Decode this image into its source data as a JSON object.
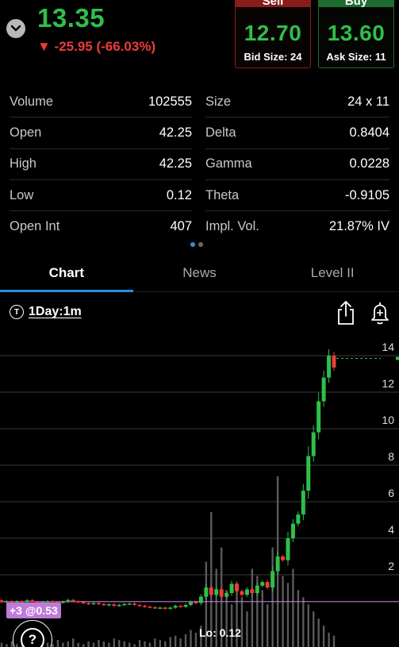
{
  "quote": {
    "last_price": "13.35",
    "change": "▼ -25.95 (-66.03%)"
  },
  "sell": {
    "label": "Sell",
    "price": "12.70",
    "size_text": "Bid Size: 24"
  },
  "buy": {
    "label": "Buy",
    "price": "13.60",
    "size_text": "Ask Size: 11"
  },
  "stats_left": [
    {
      "label": "Volume",
      "value": "102555"
    },
    {
      "label": "Open",
      "value": "42.25"
    },
    {
      "label": "High",
      "value": "42.25"
    },
    {
      "label": "Low",
      "value": "0.12"
    },
    {
      "label": "Open Int",
      "value": "407"
    }
  ],
  "stats_right": [
    {
      "label": "Size",
      "value": "24 x 11"
    },
    {
      "label": "Delta",
      "value": "0.8404"
    },
    {
      "label": "Gamma",
      "value": "0.0228"
    },
    {
      "label": "Theta",
      "value": "-0.9105"
    },
    {
      "label": "Impl. Vol.",
      "value": "21.87% IV"
    }
  ],
  "tabs": [
    {
      "label": "Chart",
      "active": true
    },
    {
      "label": "News",
      "active": false
    },
    {
      "label": "Level II",
      "active": false
    }
  ],
  "toolbar": {
    "interval_icon": "T",
    "interval_label": "1Day:1m"
  },
  "chart": {
    "position_tag": "+3 @0.53",
    "low_label": "Lo: 0.12",
    "help_label": "?",
    "colors": {
      "up": "#2fbf4a",
      "down": "#ef3b3b",
      "grid": "#3a3a3a",
      "volume": "#5a5a5a",
      "position": "#c07ad8"
    }
  },
  "chart_data": {
    "type": "candlestick",
    "y_ticks": [
      "2",
      "4",
      "6",
      "8",
      "10",
      "12",
      "14"
    ],
    "ylim": [
      0,
      15
    ],
    "last_price": 13.35,
    "low": 0.12,
    "position_price": 0.53,
    "candles": [
      {
        "o": 0.6,
        "c": 0.5
      },
      {
        "o": 0.5,
        "c": 0.55
      },
      {
        "o": 0.55,
        "c": 0.45
      },
      {
        "o": 0.45,
        "c": 0.55
      },
      {
        "o": 0.55,
        "c": 0.5
      },
      {
        "o": 0.5,
        "c": 0.6
      },
      {
        "o": 0.6,
        "c": 0.5
      },
      {
        "o": 0.5,
        "c": 0.45
      },
      {
        "o": 0.45,
        "c": 0.5
      },
      {
        "o": 0.5,
        "c": 0.55
      },
      {
        "o": 0.55,
        "c": 0.5
      },
      {
        "o": 0.5,
        "c": 0.48
      },
      {
        "o": 0.48,
        "c": 0.52
      },
      {
        "o": 0.52,
        "c": 0.62
      },
      {
        "o": 0.62,
        "c": 0.55
      },
      {
        "o": 0.55,
        "c": 0.5
      },
      {
        "o": 0.5,
        "c": 0.45
      },
      {
        "o": 0.45,
        "c": 0.4
      },
      {
        "o": 0.4,
        "c": 0.45
      },
      {
        "o": 0.45,
        "c": 0.4
      },
      {
        "o": 0.4,
        "c": 0.35
      },
      {
        "o": 0.35,
        "c": 0.38
      },
      {
        "o": 0.38,
        "c": 0.3
      },
      {
        "o": 0.3,
        "c": 0.35
      },
      {
        "o": 0.35,
        "c": 0.4
      },
      {
        "o": 0.4,
        "c": 0.42
      },
      {
        "o": 0.42,
        "c": 0.35
      },
      {
        "o": 0.35,
        "c": 0.3
      },
      {
        "o": 0.3,
        "c": 0.25
      },
      {
        "o": 0.25,
        "c": 0.22
      },
      {
        "o": 0.22,
        "c": 0.18
      },
      {
        "o": 0.18,
        "c": 0.2
      },
      {
        "o": 0.2,
        "c": 0.15
      },
      {
        "o": 0.15,
        "c": 0.2
      },
      {
        "o": 0.2,
        "c": 0.3
      },
      {
        "o": 0.3,
        "c": 0.25
      },
      {
        "o": 0.25,
        "c": 0.35
      },
      {
        "o": 0.35,
        "c": 0.5
      },
      {
        "o": 0.5,
        "c": 0.45
      },
      {
        "o": 0.45,
        "c": 0.8
      },
      {
        "o": 0.8,
        "c": 1.3
      },
      {
        "o": 1.3,
        "c": 0.9
      },
      {
        "o": 0.9,
        "c": 1.2
      },
      {
        "o": 1.2,
        "c": 0.8
      },
      {
        "o": 0.8,
        "c": 1.0
      },
      {
        "o": 1.0,
        "c": 1.5
      },
      {
        "o": 1.5,
        "c": 1.1
      },
      {
        "o": 1.1,
        "c": 0.9
      },
      {
        "o": 0.9,
        "c": 1.2
      },
      {
        "o": 1.2,
        "c": 1.0
      },
      {
        "o": 1.0,
        "c": 1.4
      },
      {
        "o": 1.4,
        "c": 1.6
      },
      {
        "o": 1.6,
        "c": 1.3
      },
      {
        "o": 1.3,
        "c": 2.2
      },
      {
        "o": 2.2,
        "c": 3.0
      },
      {
        "o": 3.0,
        "c": 2.8
      },
      {
        "o": 2.8,
        "c": 4.0
      },
      {
        "o": 4.0,
        "c": 4.8
      },
      {
        "o": 4.8,
        "c": 5.3
      },
      {
        "o": 5.3,
        "c": 6.6
      },
      {
        "o": 6.6,
        "c": 8.5
      },
      {
        "o": 8.5,
        "c": 9.8
      },
      {
        "o": 9.8,
        "c": 11.5
      },
      {
        "o": 11.5,
        "c": 12.8
      },
      {
        "o": 12.8,
        "c": 14.0
      },
      {
        "o": 14.0,
        "c": 13.35
      }
    ],
    "volumes": [
      3,
      2,
      4,
      2,
      5,
      3,
      2,
      6,
      4,
      3,
      2,
      5,
      3,
      4,
      6,
      3,
      2,
      4,
      3,
      5,
      4,
      3,
      6,
      5,
      4,
      3,
      2,
      5,
      4,
      3,
      6,
      5,
      4,
      7,
      8,
      6,
      9,
      12,
      10,
      15,
      60,
      95,
      55,
      70,
      40,
      30,
      45,
      35,
      25,
      55,
      50,
      40,
      30,
      70,
      120,
      50,
      45,
      55,
      40,
      35,
      30,
      25,
      20,
      15,
      10,
      8
    ]
  }
}
